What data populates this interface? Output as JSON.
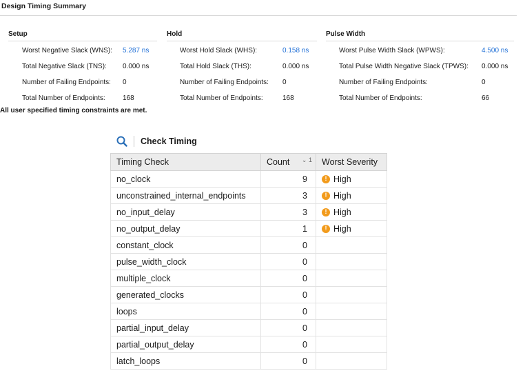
{
  "page_title": "Design Timing Summary",
  "setup": {
    "title": "Setup",
    "rows": [
      {
        "label": "Worst Negative Slack (WNS):",
        "value": "5.287 ns",
        "link": true
      },
      {
        "label": "Total Negative Slack (TNS):",
        "value": "0.000 ns",
        "link": false
      },
      {
        "label": "Number of Failing Endpoints:",
        "value": "0",
        "link": false
      },
      {
        "label": "Total Number of Endpoints:",
        "value": "168",
        "link": false
      }
    ]
  },
  "hold": {
    "title": "Hold",
    "rows": [
      {
        "label": "Worst Hold Slack (WHS):",
        "value": "0.158 ns",
        "link": true
      },
      {
        "label": "Total Hold Slack (THS):",
        "value": "0.000 ns",
        "link": false
      },
      {
        "label": "Number of Failing Endpoints:",
        "value": "0",
        "link": false
      },
      {
        "label": "Total Number of Endpoints:",
        "value": "168",
        "link": false
      }
    ]
  },
  "pulse_width": {
    "title": "Pulse Width",
    "rows": [
      {
        "label": "Worst Pulse Width Slack (WPWS):",
        "value": "4.500 ns",
        "link": true
      },
      {
        "label": "Total Pulse Width Negative Slack (TPWS):",
        "value": "0.000 ns",
        "link": false
      },
      {
        "label": "Number of Failing Endpoints:",
        "value": "0",
        "link": false
      },
      {
        "label": "Total Number of Endpoints:",
        "value": "66",
        "link": false
      }
    ]
  },
  "constraints_message": "All user specified timing constraints are met.",
  "check_timing": {
    "title": "Check Timing",
    "headers": {
      "check": "Timing Check",
      "count": "Count",
      "sort": "1",
      "severity": "Worst Severity"
    },
    "rows": [
      {
        "check": "no_clock",
        "count": "9",
        "severity": "High"
      },
      {
        "check": "unconstrained_internal_endpoints",
        "count": "3",
        "severity": "High"
      },
      {
        "check": "no_input_delay",
        "count": "3",
        "severity": "High"
      },
      {
        "check": "no_output_delay",
        "count": "1",
        "severity": "High"
      },
      {
        "check": "constant_clock",
        "count": "0",
        "severity": ""
      },
      {
        "check": "pulse_width_clock",
        "count": "0",
        "severity": ""
      },
      {
        "check": "multiple_clock",
        "count": "0",
        "severity": ""
      },
      {
        "check": "generated_clocks",
        "count": "0",
        "severity": ""
      },
      {
        "check": "loops",
        "count": "0",
        "severity": ""
      },
      {
        "check": "partial_input_delay",
        "count": "0",
        "severity": ""
      },
      {
        "check": "partial_output_delay",
        "count": "0",
        "severity": ""
      },
      {
        "check": "latch_loops",
        "count": "0",
        "severity": ""
      }
    ]
  },
  "colors": {
    "link": "#1f6fd6",
    "warning": "#f29b1c",
    "header_bg": "#ececec"
  },
  "icons": {
    "search": "search-icon",
    "severity": "warning-icon",
    "sort": "chevron-down-icon"
  }
}
